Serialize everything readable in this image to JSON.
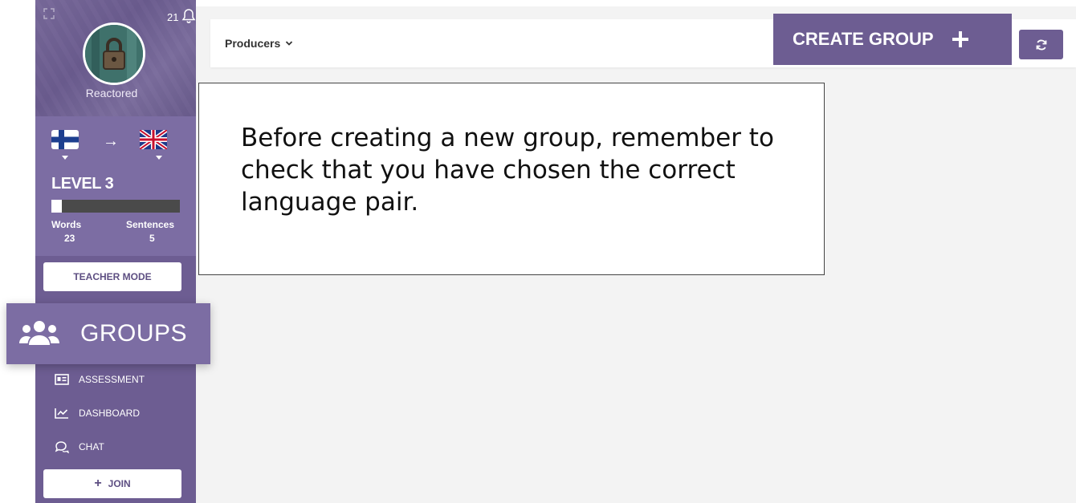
{
  "notifications": {
    "count": "21",
    "icon": "bell-icon"
  },
  "profile": {
    "username": "Reactored"
  },
  "language_pair": {
    "from_flag": "finland-flag",
    "to_flag": "uk-flag",
    "arrow": "→"
  },
  "level": {
    "label": "LEVEL 3",
    "progress_fraction": 0.08,
    "words_label": "Words",
    "words_value": "23",
    "sentences_label": "Sentences",
    "sentences_value": "5"
  },
  "sidebar": {
    "teacher_mode": "TEACHER MODE",
    "groups": "GROUPS",
    "items": [
      {
        "label": "ASSESSMENT",
        "icon": "id-card-icon"
      },
      {
        "label": "DASHBOARD",
        "icon": "chart-line-icon"
      },
      {
        "label": "CHAT",
        "icon": "chat-icon"
      }
    ],
    "join_plus": "+",
    "join_label": "JOIN"
  },
  "topbar": {
    "filter_label": "Producers",
    "create_group": "CREATE GROUP",
    "create_plus": "+"
  },
  "tooltip": {
    "text": "Before creating a new group, remember to check that you have chosen the correct language pair."
  },
  "colors": {
    "sidebar": "#6d5d92",
    "sidebar_light": "#7c6da3",
    "button_accent": "#6d5d92",
    "content_bg": "#f3f3f3"
  }
}
